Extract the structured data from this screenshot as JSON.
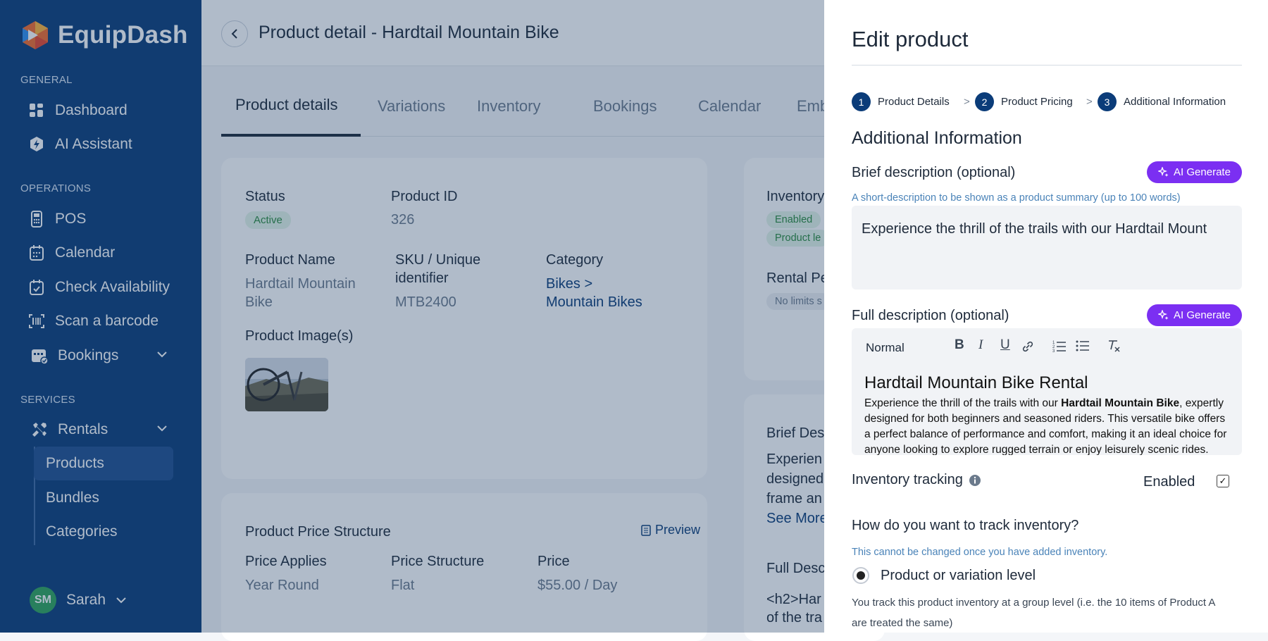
{
  "app": {
    "name": "EquipDash"
  },
  "sidebar": {
    "sections": {
      "general": "GENERAL",
      "operations": "OPERATIONS",
      "services": "SERVICES"
    },
    "items": {
      "dashboard": "Dashboard",
      "ai_assistant": "AI Assistant",
      "pos": "POS",
      "calendar": "Calendar",
      "check_availability": "Check Availability",
      "scan_barcode": "Scan a barcode",
      "bookings": "Bookings",
      "rentals": "Rentals",
      "products": "Products",
      "bundles": "Bundles",
      "categories": "Categories"
    },
    "user": {
      "initials": "SM",
      "name": "Sarah"
    }
  },
  "header": {
    "title": "Product detail - Hardtail Mountain Bike"
  },
  "tabs": [
    "Product details",
    "Variations",
    "Inventory",
    "Bookings",
    "Calendar",
    "Embed"
  ],
  "details": {
    "status_label": "Status",
    "status_value": "Active",
    "product_id_label": "Product ID",
    "product_id_value": "326",
    "name_label": "Product Name",
    "name_value_1": "Hardtail Mountain",
    "name_value_2": "Bike",
    "sku_label_1": "SKU / Unique",
    "sku_label_2": "identifier",
    "sku_value": "MTB2400",
    "category_label": "Category",
    "category_value_1": "Bikes",
    "category_sep": ">",
    "category_value_2": "Mountain Bikes",
    "images_label": "Product Image(s)"
  },
  "price": {
    "title": "Product Price Structure",
    "preview": "Preview",
    "applies_label": "Price Applies",
    "applies_value": "Year Round",
    "structure_label": "Price Structure",
    "structure_value": "Flat",
    "price_label": "Price",
    "price_value": "$55.00 / Day"
  },
  "right_col": {
    "inventory_label": "Inventory",
    "enabled_badge": "Enabled",
    "product_level_badge": "Product le",
    "rental_label": "Rental Pe",
    "no_limits": "No limits s",
    "brief_label": "Brief Des",
    "brief_line1": "Experien",
    "brief_line2": "designed",
    "brief_line3": "frame an",
    "see_more": "See More",
    "full_label": "Full Desc",
    "full_line1": "<h2>Har",
    "full_line2": "of the tra"
  },
  "panel": {
    "title": "Edit product",
    "steps": [
      {
        "num": "1",
        "label": "Product Details"
      },
      {
        "num": "2",
        "label": "Product Pricing"
      },
      {
        "num": "3",
        "label": "Additional Information"
      }
    ],
    "step_sep": ">",
    "section_title": "Additional Information",
    "brief_label": "Brief description (optional)",
    "ai_generate": "AI Generate",
    "brief_hint": "A short-description to be shown as a product summary (up to 100 words)",
    "brief_value": "Experience the thrill of the trails with our Hardtail Mount",
    "full_label": "Full description (optional)",
    "editor": {
      "format": "Normal",
      "heading": "Hardtail Mountain Bike Rental",
      "para_start": "Experience the thrill of the trails with our ",
      "para_bold": "Hardtail Mountain Bike",
      "para_end": ", expertly designed for both beginners and seasoned riders. This versatile bike offers a perfect balance of performance and comfort, making it an ideal choice for anyone looking to explore rugged terrain or enjoy leisurely scenic rides."
    },
    "inventory_label": "Inventory tracking",
    "inventory_value": "Enabled",
    "track_question": "How do you want to track inventory?",
    "track_hint": "This cannot be changed once you have added inventory.",
    "option_label": "Product or variation level",
    "option_desc_1": "You track this product inventory at a group level (i.e. the 10 items of Product A",
    "option_desc_2": "are treated the same)"
  },
  "colors": {
    "sidebar": "#0b3c79",
    "accent_ai": "#7b2ff2",
    "active_badge": "#2a8a3e"
  }
}
